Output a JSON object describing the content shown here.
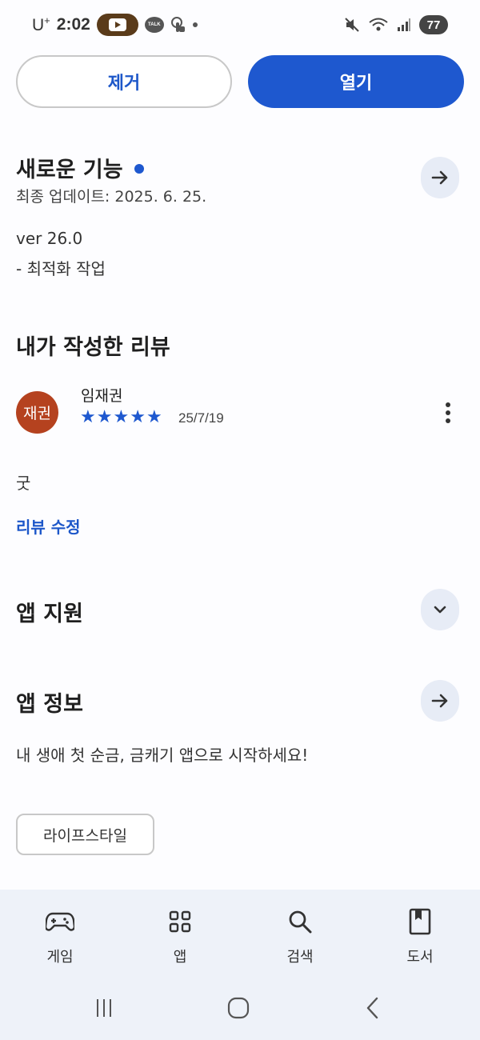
{
  "status_bar": {
    "carrier": "U",
    "carrier_sup": "+",
    "time": "2:02",
    "talk_label": "TALK",
    "battery": "77"
  },
  "actions": {
    "remove_label": "제거",
    "open_label": "열기"
  },
  "whats_new": {
    "title": "새로운 기능",
    "last_updated": "최종 업데이트: 2025. 6. 25.",
    "version": "ver 26.0",
    "note": "- 최적화 작업"
  },
  "my_review": {
    "title": "내가 작성한 리뷰",
    "avatar_text": "재권",
    "reviewer_name": "임재권",
    "rating": 5,
    "stars": [
      "★",
      "★",
      "★",
      "★",
      "★"
    ],
    "date": "25/7/19",
    "text": "굿",
    "edit_link": "리뷰 수정"
  },
  "app_support": {
    "title": "앱 지원"
  },
  "app_info": {
    "title": "앱 정보",
    "description": "내 생애 첫 순금, 금캐기 앱으로 시작하세요!",
    "category_chip": "라이프스타일"
  },
  "bottom_nav": {
    "items": [
      {
        "label": "게임",
        "icon": "gamepad-icon"
      },
      {
        "label": "앱",
        "icon": "apps-grid-icon"
      },
      {
        "label": "검색",
        "icon": "search-icon"
      },
      {
        "label": "도서",
        "icon": "book-icon"
      }
    ]
  },
  "colors": {
    "accent": "#1e58cf",
    "avatar": "#b5421f",
    "round_button_bg": "#e7ecf6",
    "nav_bg": "#eef2f9"
  }
}
